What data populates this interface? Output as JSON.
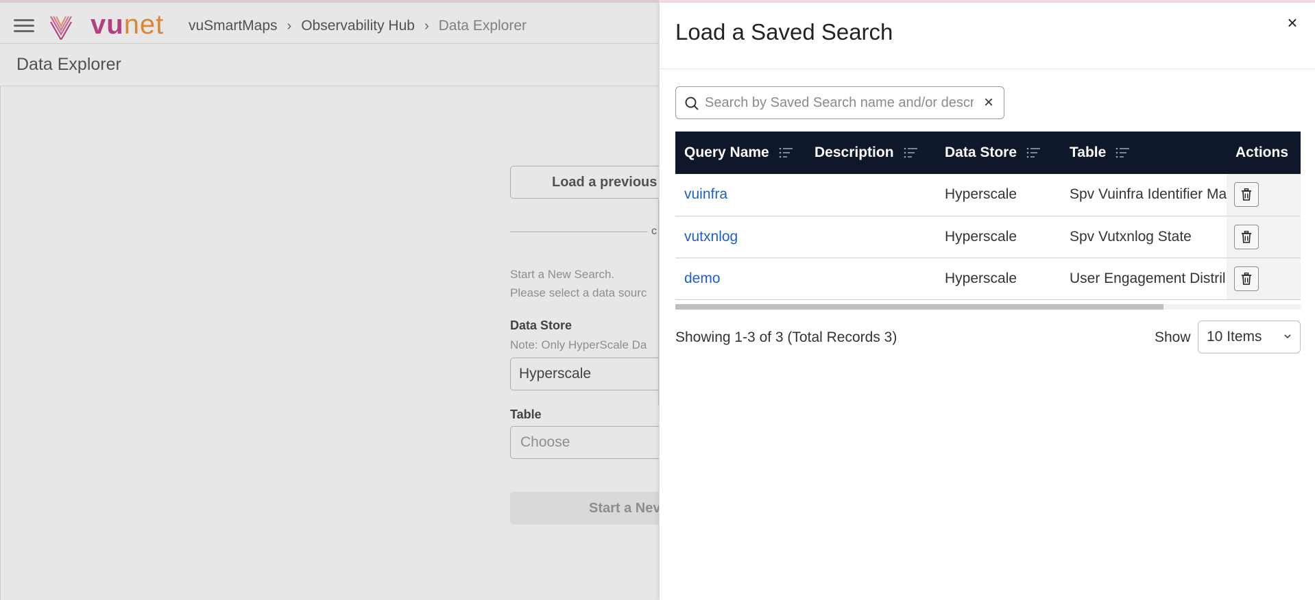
{
  "header": {
    "logo_vu": "vu",
    "logo_net": "net",
    "breadcrumb": [
      "vuSmartMaps",
      "Observability Hub",
      "Data Explorer"
    ],
    "breadcrumb_sep": "›"
  },
  "page": {
    "title": "Data Explorer",
    "load_previous_label": "Load a previous",
    "or_text": "c",
    "start_new_line1": "Start a New Search.",
    "start_new_line2": "Please select a data sourc",
    "data_store_label": "Data Store",
    "data_store_note": "Note: Only HyperScale Da",
    "data_store_value": "Hyperscale",
    "table_label": "Table",
    "table_placeholder": "Choose",
    "start_new_button": "Start a Nev"
  },
  "flyout": {
    "title": "Load a Saved Search",
    "close_glyph": "×",
    "search_placeholder": "Search by Saved Search name and/or description",
    "clear_glyph": "×",
    "columns": [
      "Query Name",
      "Description",
      "Data Store",
      "Table",
      "Actions"
    ],
    "rows": [
      {
        "query_name": "vuinfra",
        "description": "",
        "data_store": "Hyperscale",
        "table": "Spv Vuinfra Identifier Ma"
      },
      {
        "query_name": "vutxnlog",
        "description": "",
        "data_store": "Hyperscale",
        "table": "Spv Vutxnlog State"
      },
      {
        "query_name": "demo",
        "description": "",
        "data_store": "Hyperscale",
        "table": "User Engagement Distril"
      }
    ],
    "showing_text": "Showing 1-3 of 3 (Total Records 3)",
    "show_label": "Show",
    "items_per_page": "10 Items"
  },
  "colors": {
    "table_header_bg": "#0f172a",
    "link": "#1f5fc9",
    "logo_vu": "#c2418a",
    "logo_net": "#f0913a"
  }
}
